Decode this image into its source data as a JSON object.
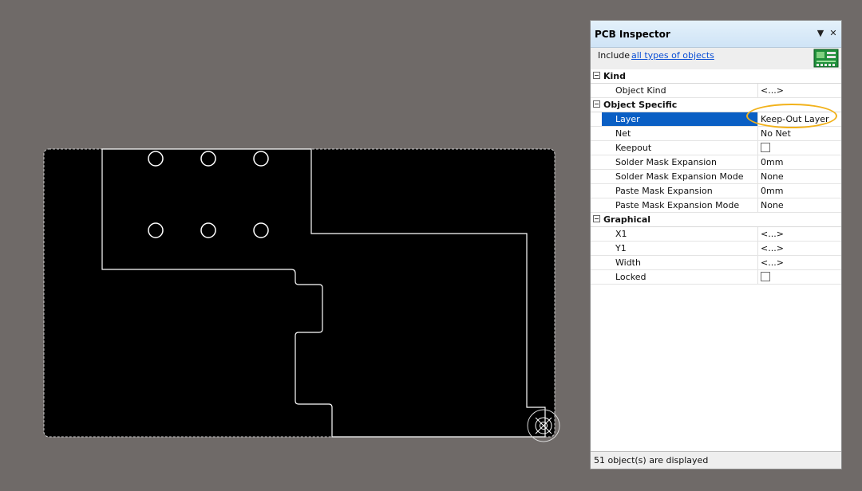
{
  "inspector": {
    "title": "PCB Inspector",
    "dropdown_glyph": "▼",
    "close_glyph": "✕",
    "include_label": "Include",
    "include_link": "all types of objects",
    "board_icon": "pcb-board-icon",
    "categories": [
      {
        "label": "Kind",
        "rows": [
          {
            "name": "Object Kind",
            "value": "<...>"
          }
        ]
      },
      {
        "label": "Object Specific",
        "rows": [
          {
            "name": "Layer",
            "value": "Keep-Out Layer",
            "selected": true
          },
          {
            "name": "Net",
            "value": "No Net"
          },
          {
            "name": "Keepout",
            "value": "",
            "checkbox": true,
            "checked": false
          },
          {
            "name": "Solder Mask Expansion",
            "value": "0mm"
          },
          {
            "name": "Solder Mask Expansion Mode",
            "value": "None"
          },
          {
            "name": "Paste Mask Expansion",
            "value": "0mm"
          },
          {
            "name": "Paste Mask Expansion Mode",
            "value": "None"
          }
        ]
      },
      {
        "label": "Graphical",
        "rows": [
          {
            "name": "X1",
            "value": "<...>"
          },
          {
            "name": "Y1",
            "value": "<...>"
          },
          {
            "name": "Width",
            "value": "<...>"
          },
          {
            "name": "Locked",
            "value": "",
            "checkbox": true,
            "checked": false
          }
        ]
      }
    ],
    "status": "51 object(s) are displayed"
  },
  "colors": {
    "workspace_bg": "#6f6a68",
    "board_fill": "#000000",
    "board_outline": "#ffffff",
    "selection_blue": "#0a5fc4",
    "highlight_ring": "#f2b21b",
    "link": "#0b4fd6"
  }
}
